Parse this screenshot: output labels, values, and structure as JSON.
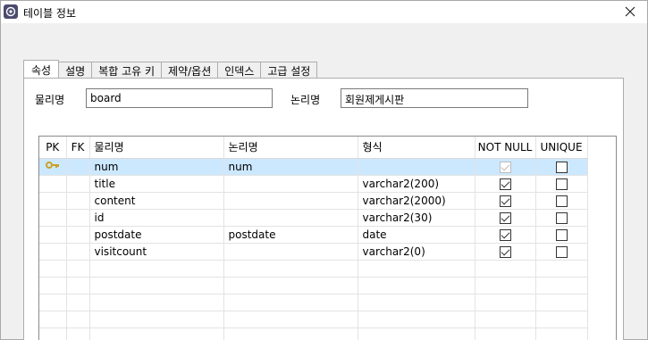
{
  "window": {
    "title": "테이블 정보"
  },
  "tabs": [
    {
      "label": "속성",
      "active": true
    },
    {
      "label": "설명",
      "active": false
    },
    {
      "label": "복합 고유 키",
      "active": false
    },
    {
      "label": "제약/옵션",
      "active": false
    },
    {
      "label": "인덱스",
      "active": false
    },
    {
      "label": "고급 설정",
      "active": false
    }
  ],
  "table_info": {
    "physical_label": "물리명",
    "physical_value": "board",
    "logical_label": "논리명",
    "logical_value": "회원제게시판"
  },
  "columns_grid": {
    "headers": {
      "pk": "PK",
      "fk": "FK",
      "physical": "물리명",
      "logical": "논리명",
      "type": "형식",
      "not_null": "NOT NULL",
      "unique": "UNIQUE"
    },
    "rows": [
      {
        "pk": true,
        "fk": false,
        "physical": "num",
        "logical": "num",
        "type": "",
        "not_null": true,
        "unique": false,
        "selected": true
      },
      {
        "pk": false,
        "fk": false,
        "physical": "title",
        "logical": "",
        "type": "varchar2(200)",
        "not_null": true,
        "unique": false,
        "selected": false
      },
      {
        "pk": false,
        "fk": false,
        "physical": "content",
        "logical": "",
        "type": "varchar2(2000)",
        "not_null": true,
        "unique": false,
        "selected": false
      },
      {
        "pk": false,
        "fk": false,
        "physical": "id",
        "logical": "",
        "type": "varchar2(30)",
        "not_null": true,
        "unique": false,
        "selected": false
      },
      {
        "pk": false,
        "fk": false,
        "physical": "postdate",
        "logical": "postdate",
        "type": "date",
        "not_null": true,
        "unique": false,
        "selected": false
      },
      {
        "pk": false,
        "fk": false,
        "physical": "visitcount",
        "logical": "",
        "type": "varchar2(0)",
        "not_null": true,
        "unique": false,
        "selected": false
      }
    ],
    "empty_rows": 5
  },
  "colors": {
    "selection": "#cce8ff",
    "key_icon": "#c9a227"
  },
  "icons": {
    "app": "database-app-icon",
    "close": "close-icon",
    "primary_key": "key-icon"
  }
}
